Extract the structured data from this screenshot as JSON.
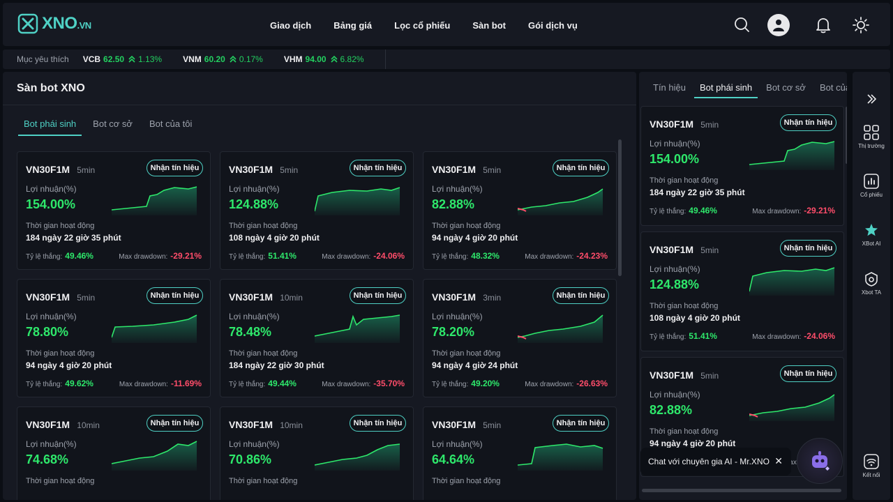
{
  "header": {
    "logo_text": "XNO",
    "logo_suffix": ".VN",
    "nav": [
      "Giao dịch",
      "Bảng giá",
      "Lọc cổ phiếu",
      "Sàn bot",
      "Gói dịch vụ"
    ],
    "icons": [
      "search-icon",
      "user-avatar-icon",
      "bell-icon",
      "sun-icon"
    ]
  },
  "ticker": {
    "label": "Mục yêu thích",
    "items": [
      {
        "symbol": "VCB",
        "price": "62.50",
        "change": "1.13%"
      },
      {
        "symbol": "VNM",
        "price": "60.20",
        "change": "0.17%"
      },
      {
        "symbol": "VHM",
        "price": "94.00",
        "change": "6.82%"
      }
    ]
  },
  "main": {
    "title": "Sàn bot XNO",
    "tabs": [
      "Bot phái sinh",
      "Bot cơ sở",
      "Bot của tôi"
    ],
    "active_tab": 0,
    "labels": {
      "profit": "Lợi nhuận(%)",
      "runtime": "Thời gian hoạt động",
      "winrate": "Tỷ lệ thắng:",
      "drawdown": "Max drawdown:",
      "signal_button": "Nhận tín hiệu"
    },
    "cards": [
      {
        "symbol": "VN30F1M",
        "timeframe": "5min",
        "profit": "154.00%",
        "runtime": "184 ngày 22 giờ 35 phút",
        "winrate": "49.46%",
        "drawdown": "-29.21%"
      },
      {
        "symbol": "VN30F1M",
        "timeframe": "5min",
        "profit": "124.88%",
        "runtime": "108 ngày 4 giờ 20 phút",
        "winrate": "51.41%",
        "drawdown": "-24.06%"
      },
      {
        "symbol": "VN30F1M",
        "timeframe": "5min",
        "profit": "82.88%",
        "runtime": "94 ngày 4 giờ 20 phút",
        "winrate": "48.32%",
        "drawdown": "-24.23%"
      },
      {
        "symbol": "VN30F1M",
        "timeframe": "5min",
        "profit": "78.80%",
        "runtime": "94 ngày 4 giờ 20 phút",
        "winrate": "49.62%",
        "drawdown": "-11.69%"
      },
      {
        "symbol": "VN30F1M",
        "timeframe": "10min",
        "profit": "78.48%",
        "runtime": "184 ngày 22 giờ 30 phút",
        "winrate": "49.44%",
        "drawdown": "-35.70%"
      },
      {
        "symbol": "VN30F1M",
        "timeframe": "3min",
        "profit": "78.20%",
        "runtime": "94 ngày 4 giờ 24 phút",
        "winrate": "49.20%",
        "drawdown": "-26.63%"
      },
      {
        "symbol": "VN30F1M",
        "timeframe": "10min",
        "profit": "74.68%",
        "runtime": "",
        "winrate": "",
        "drawdown": ""
      },
      {
        "symbol": "VN30F1M",
        "timeframe": "10min",
        "profit": "70.86%",
        "runtime": "",
        "winrate": "",
        "drawdown": ""
      },
      {
        "symbol": "VN30F1M",
        "timeframe": "5min",
        "profit": "64.64%",
        "runtime": "",
        "winrate": "",
        "drawdown": ""
      }
    ]
  },
  "side": {
    "tabs": [
      "Tín hiệu",
      "Bot phái sinh",
      "Bot cơ sở",
      "Bot của tôi"
    ],
    "active_tab": 1,
    "cards": [
      {
        "symbol": "VN30F1M",
        "timeframe": "5min",
        "profit": "154.00%",
        "runtime": "184 ngày 22 giờ 35 phút",
        "winrate": "49.46%",
        "drawdown": "-29.21%"
      },
      {
        "symbol": "VN30F1M",
        "timeframe": "5min",
        "profit": "124.88%",
        "runtime": "108 ngày 4 giờ 20 phút",
        "winrate": "51.41%",
        "drawdown": "-24.06%"
      },
      {
        "symbol": "VN30F1M",
        "timeframe": "5min",
        "profit": "82.88%",
        "runtime": "94 ngày 4 giờ 20 phút",
        "winrate": "",
        "drawdown": ""
      }
    ]
  },
  "chat": {
    "text": "Chat với chuyên gia AI - Mr.XNO",
    "close": "✕"
  },
  "rail": {
    "items": [
      {
        "label": "",
        "icon": "chevron-right-icon"
      },
      {
        "label": "Thị trường",
        "icon": "grid-icon"
      },
      {
        "label": "Cổ phiếu",
        "icon": "chart-icon"
      },
      {
        "label": "XBot AI",
        "icon": "star-icon"
      },
      {
        "label": "Xbot TA",
        "icon": "shield-icon"
      },
      {
        "label": "Kết nối",
        "icon": "wifi-icon"
      }
    ]
  },
  "colors": {
    "accent": "#4fd1c5",
    "positive": "#2ee86b",
    "negative": "#ff4d6a",
    "background": "#0b0e14",
    "panel": "#161922"
  }
}
